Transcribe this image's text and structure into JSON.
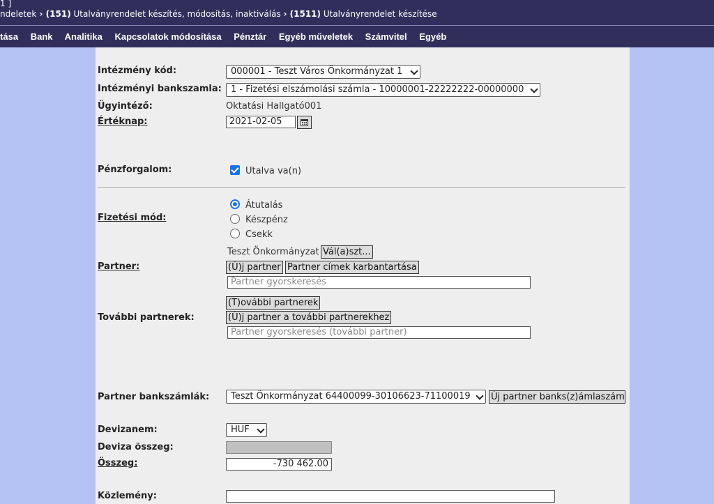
{
  "header": {
    "line1": "1 ]",
    "breadcrumb": [
      {
        "text": "ndeletek",
        "bold": false
      },
      {
        "text": " › ",
        "bold": true
      },
      {
        "text": "(151)",
        "bold": true
      },
      {
        "text": " Utalványrendelet készítés, módosítás, inaktiválás ",
        "bold": false
      },
      {
        "text": "› ",
        "bold": true
      },
      {
        "text": "(1511)",
        "bold": true
      },
      {
        "text": " Utalványrendelet készítése",
        "bold": false
      }
    ],
    "menu": [
      "rtása",
      "Bank",
      "Analitika",
      "Kapcsolatok módosítása",
      "Pénztár",
      "Egyéb műveletek",
      "Számvitel",
      "Egyéb"
    ]
  },
  "form": {
    "institution_code": {
      "label": "Intézmény kód:",
      "value": "000001 - Teszt Város Önkormányzat 1"
    },
    "bank_account": {
      "label": "Intézményi bankszamla:",
      "value": "1 - Fizetési elszámolási számla - 10000001-22222222-00000000"
    },
    "administrator": {
      "label": "Ügyintéző:",
      "value": "Oktatási Hallgató001"
    },
    "value_date": {
      "label": "Értéknap:",
      "value": "2021-02-05"
    },
    "cash_flow": {
      "label": "Pénzforgalom:",
      "checkbox_label": "Utalva va(n)",
      "checked": true
    },
    "payment_method": {
      "label": "Fizetési mód:",
      "options": [
        "Átutalás",
        "Készpénz",
        "Csekk"
      ],
      "selected": "Átutalás"
    },
    "partner": {
      "label": "Partner:",
      "name": "Teszt Önkormányzat",
      "select_button": "Vál(a)szt...",
      "new_button": "(Ú)j partner",
      "address_button": "Partner címek karbantartása",
      "search_placeholder": "Partner gyorskeresés"
    },
    "other_partners": {
      "label": "További partnerek:",
      "list_button": "(T)ovábbi partnerek",
      "new_button": "(Ú)j partner a további partnerekhez",
      "search_placeholder": "Partner gyorskeresés (további partner)"
    },
    "partner_bank": {
      "label": "Partner bankszámlák:",
      "value": "Teszt Önkormányzat 64400099-30106623-71100019",
      "new_button": "Új partner banks(z)ámlaszám"
    },
    "currency": {
      "label": "Devizanem:",
      "value": "HUF"
    },
    "currency_amount": {
      "label": "Deviza összeg:",
      "value": ""
    },
    "amount": {
      "label": "Összeg:",
      "value": "-730 462.00"
    },
    "notice": {
      "label": "Közlemény:",
      "value": ""
    }
  },
  "colors": {
    "header_bg": "#322e5c",
    "page_bg": "#b4c2f4",
    "panel_bg": "#eeeeee",
    "accent": "#1a73e8"
  }
}
